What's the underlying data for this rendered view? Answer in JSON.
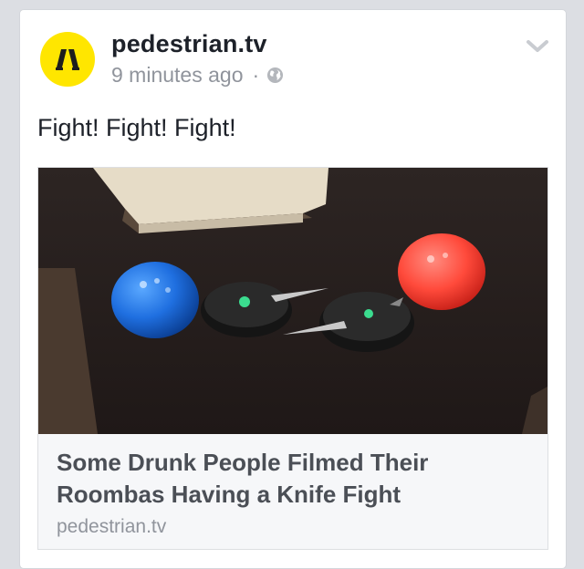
{
  "post": {
    "page_name": "pedestrian.tv",
    "timestamp": "9 minutes ago",
    "separator": "·",
    "privacy_icon": "globe-icon",
    "menu_icon": "chevron-down-icon",
    "text": "Fight! Fight! Fight!"
  },
  "avatar": {
    "icon": "pedestrian-logo",
    "background": "#ffe600"
  },
  "link": {
    "title": "Some Drunk People Filmed Their Roombas Having a Knife Fight",
    "domain": "pedestrian.tv"
  },
  "colors": {
    "background": "#dcdee3",
    "card": "#ffffff",
    "link_footer": "#f6f7f9",
    "text_primary": "#1d2129",
    "text_secondary": "#90949c"
  }
}
